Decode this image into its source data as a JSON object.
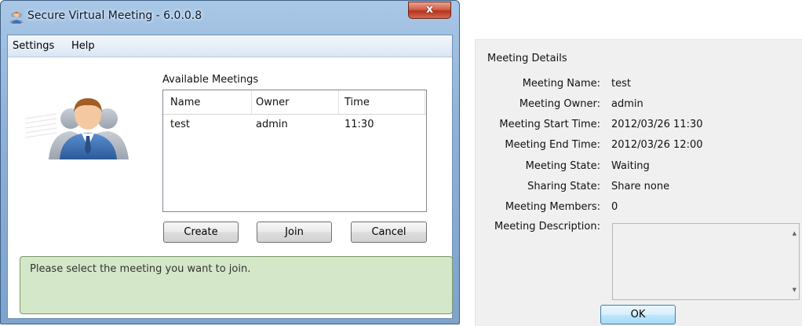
{
  "main_window": {
    "title": "Secure Virtual Meeting - 6.0.0.8",
    "icon": "meeting-user-icon",
    "close_glyph": "x",
    "menu": [
      "Settings",
      "Help"
    ],
    "meetings_label": "Available Meetings",
    "columns": [
      "Name",
      "Owner",
      "Time"
    ],
    "rows": [
      {
        "name": "test",
        "owner": "admin",
        "time": "11:30"
      }
    ],
    "buttons": {
      "create": "Create",
      "join": "Join",
      "cancel": "Cancel"
    },
    "status": "Please select the meeting you want to join."
  },
  "details_dialog": {
    "title": "Meeting Details",
    "fields": [
      {
        "label": "Meeting Name:",
        "value": "test"
      },
      {
        "label": "Meeting Owner:",
        "value": "admin"
      },
      {
        "label": "Meeting Start Time:",
        "value": "2012/03/26 11:30"
      },
      {
        "label": "Meeting End Time:",
        "value": "2012/03/26 12:00"
      },
      {
        "label": "Meeting State:",
        "value": "Waiting"
      },
      {
        "label": "Sharing State:",
        "value": "Share none"
      },
      {
        "label": "Meeting Members:",
        "value": "0"
      }
    ],
    "description_label": "Meeting Description:",
    "description_value": "",
    "ok": "OK"
  },
  "colors": {
    "status_bg": "#d4e7c8",
    "titlebar": "#8db1d8",
    "close_button": "#c8452d"
  }
}
